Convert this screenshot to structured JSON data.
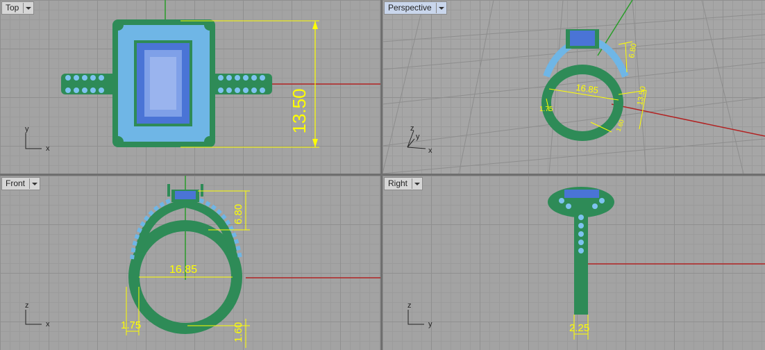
{
  "viewports": {
    "top": {
      "label": "Top",
      "axis_a": "y",
      "axis_b": "x",
      "dim_height": "13.50"
    },
    "perspective": {
      "label": "Perspective",
      "axis_a": "z",
      "axis_b": "y",
      "axis_c": "x",
      "dim_width": "16.85",
      "dim_height": "13.50",
      "dim_top": "6.80",
      "dim_side": "1.75",
      "dim_bottom": "1.60"
    },
    "front": {
      "label": "Front",
      "axis_a": "z",
      "axis_b": "x",
      "dim_width": "16.85",
      "dim_top": "6.80",
      "dim_side": "1.75",
      "dim_bottom": "1.60"
    },
    "right": {
      "label": "Right",
      "axis_a": "z",
      "axis_b": "y",
      "dim_width": "2.25"
    }
  },
  "colors": {
    "metal": "#2e8b57",
    "stone": "#7ec3f0",
    "center_stone": "#4a74d6",
    "dimension": "#ffff00",
    "x_axis": "#b22222",
    "y_axis": "#2a9d2a"
  }
}
